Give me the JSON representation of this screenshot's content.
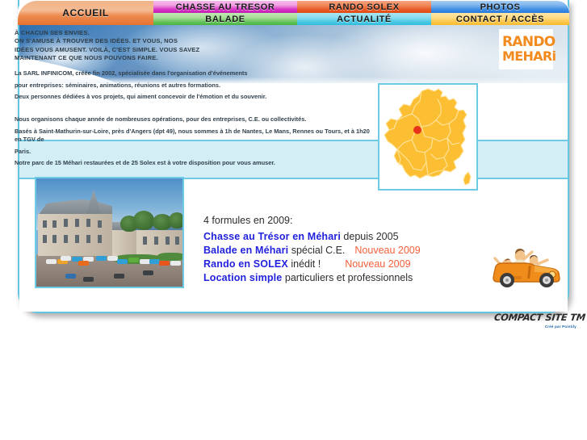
{
  "nav": {
    "items": [
      {
        "id": "accueil",
        "label": "ACCUEIL"
      },
      {
        "id": "chasse",
        "label": "CHASSE AU TRESOR"
      },
      {
        "id": "balade",
        "label": "BALADE"
      },
      {
        "id": "rando",
        "label": "RANDO SOLEX"
      },
      {
        "id": "actualite",
        "label": "ACTUALITÉ"
      },
      {
        "id": "photos",
        "label": "PHOTOS"
      },
      {
        "id": "contact",
        "label": "CONTACT / ACCÈS"
      }
    ]
  },
  "logo": {
    "line1": "RANDO",
    "line2": "MEHARi",
    "color": "#f28a1e"
  },
  "intro": {
    "caps": [
      "À CHACUN SES ENVIES.",
      "ON S'AMUSE À TROUVER DES IDÉES. ET VOUS, NOS",
      "IDÉES VOUS AMUSENT. VOILÀ, C'EST SIMPLE. VOUS SAVEZ",
      "MAINTENANT CE QUE NOUS POUVONS FAIRE."
    ],
    "para1": [
      "La SARL INFINICOM, créée fin 2002, spécialisée dans l'organisation d'événements",
      "pour entreprises: séminaires, animations, réunions et autres formations.",
      "Deux personnes dédiées à vos projets, qui aiment concevoir de l'émotion et du souvenir."
    ],
    "para2": [
      "Nous organisons chaque année de nombreuses opérations, pour des entreprises, C.E. ou collectivités.",
      "Basés à Saint-Mathurin-sur-Loire, près d'Angers (dpt 49), nous sommes à 1h de Nantes, Le Mans, Rennes ou Tours, et à 1h20 en TGV de",
      "Paris.",
      "Notre parc de 15 Méhari restaurées et de 25 Solex est à votre disposition pour vous amuser."
    ]
  },
  "map": {
    "name": "france-map",
    "fill": "#fcbf33",
    "marker_color": "#e8331c",
    "marker_label": "Saint-Mathurin-sur-Loire"
  },
  "photo": {
    "name": "chateau-with-mehari-cars"
  },
  "formules": {
    "heading": "4 formules en 2009:",
    "rows": [
      {
        "bold": "Chasse au Trésor en Méhari",
        "rest": " depuis 2005",
        "badge": ""
      },
      {
        "bold": "Balade en Méhari",
        "rest": " spécial C.E.",
        "badge": "Nouveau 2009"
      },
      {
        "bold": "Rando en SOLEX",
        "rest": " inédit !",
        "badge": "Nouveau 2009"
      },
      {
        "bold": "Location simple",
        "rest": " particuliers et professionnels",
        "badge": ""
      }
    ],
    "bold_color": "#2222dd",
    "badge_color": "#f5603c"
  },
  "clipart": {
    "name": "mehari-car-with-people"
  },
  "footer": {
    "brand": "COMPACT SITE TM",
    "sub": "Créé par Pointily"
  }
}
